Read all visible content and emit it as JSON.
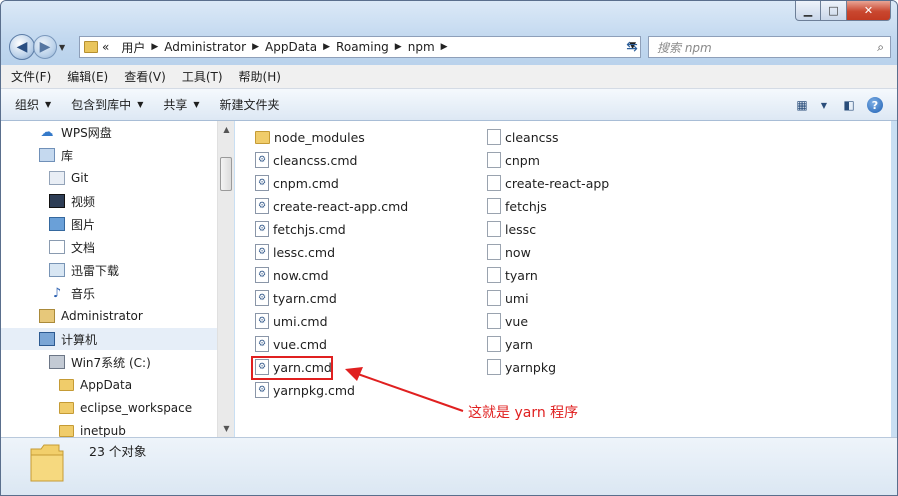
{
  "window": {
    "controls": {
      "minimize": "▁",
      "maximize": "□",
      "close": "✕"
    }
  },
  "address": {
    "overflow": "«",
    "crumbs": [
      "用户",
      "Administrator",
      "AppData",
      "Roaming",
      "npm"
    ]
  },
  "search": {
    "placeholder": "搜索 npm"
  },
  "menu": [
    "文件(F)",
    "编辑(E)",
    "查看(V)",
    "工具(T)",
    "帮助(H)"
  ],
  "toolbar": {
    "organize": "组织",
    "include_in_library": "包含到库中",
    "share": "共享",
    "new_folder": "新建文件夹"
  },
  "nav": [
    {
      "label": "WPS网盘",
      "icon": "cloud-icon"
    },
    {
      "label": "库",
      "icon": "library-icon"
    },
    {
      "label": "Git",
      "icon": "git-library-icon"
    },
    {
      "label": "视频",
      "icon": "video-icon"
    },
    {
      "label": "图片",
      "icon": "picture-icon"
    },
    {
      "label": "文档",
      "icon": "document-icon"
    },
    {
      "label": "迅雷下载",
      "icon": "xunlei-icon"
    },
    {
      "label": "音乐",
      "icon": "music-icon"
    },
    {
      "label": "Administrator",
      "icon": "user-folder-icon"
    },
    {
      "label": "计算机",
      "icon": "computer-icon"
    },
    {
      "label": "Win7系统 (C:)",
      "icon": "drive-icon"
    },
    {
      "label": "AppData",
      "icon": "folder-icon"
    },
    {
      "label": "eclipse_workspace",
      "icon": "folder-icon"
    },
    {
      "label": "inetpub",
      "icon": "folder-icon"
    }
  ],
  "files_col1": [
    {
      "name": "node_modules",
      "type": "folder"
    },
    {
      "name": "cleancss.cmd",
      "type": "cmd"
    },
    {
      "name": "cnpm.cmd",
      "type": "cmd"
    },
    {
      "name": "create-react-app.cmd",
      "type": "cmd"
    },
    {
      "name": "fetchjs.cmd",
      "type": "cmd"
    },
    {
      "name": "lessc.cmd",
      "type": "cmd"
    },
    {
      "name": "now.cmd",
      "type": "cmd"
    },
    {
      "name": "tyarn.cmd",
      "type": "cmd"
    },
    {
      "name": "umi.cmd",
      "type": "cmd"
    },
    {
      "name": "vue.cmd",
      "type": "cmd"
    },
    {
      "name": "yarn.cmd",
      "type": "cmd"
    },
    {
      "name": "yarnpkg.cmd",
      "type": "cmd"
    }
  ],
  "files_col2": [
    {
      "name": "cleancss",
      "type": "file"
    },
    {
      "name": "cnpm",
      "type": "file"
    },
    {
      "name": "create-react-app",
      "type": "file"
    },
    {
      "name": "fetchjs",
      "type": "file"
    },
    {
      "name": "lessc",
      "type": "file"
    },
    {
      "name": "now",
      "type": "file"
    },
    {
      "name": "tyarn",
      "type": "file"
    },
    {
      "name": "umi",
      "type": "file"
    },
    {
      "name": "vue",
      "type": "file"
    },
    {
      "name": "yarn",
      "type": "file"
    },
    {
      "name": "yarnpkg",
      "type": "file"
    }
  ],
  "annotation": {
    "text": "这就是 yarn 程序",
    "color": "#e02020"
  },
  "status": {
    "count_text": "23 个对象"
  }
}
